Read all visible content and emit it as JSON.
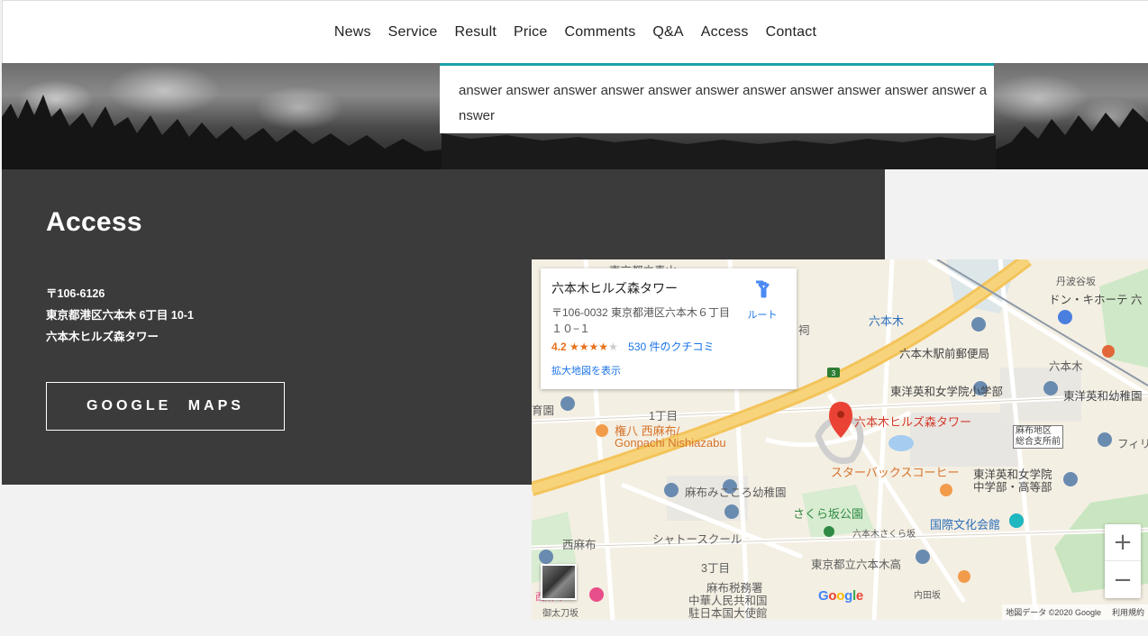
{
  "nav": {
    "items": [
      "News",
      "Service",
      "Result",
      "Price",
      "Comments",
      "Q&A",
      "Access",
      "Contact"
    ]
  },
  "qa": {
    "answer_text": "answer answer answer answer answer answer answer answer answer answer answer answer"
  },
  "access": {
    "title": "Access",
    "postal": "〒106-6126",
    "address": "東京都港区六本木 6丁目 10-1",
    "building": "六本木ヒルズ森タワー",
    "button_label": "GOOGLE MAPS"
  },
  "map": {
    "info": {
      "title": "六本木ヒルズ森タワー",
      "address": "〒106-0032 東京都港区六本木６丁目１０−１",
      "rating": "4.2",
      "stars": "★★★★",
      "reviews": "530 件のクチコミ",
      "enlarge": "拡大地図を表示",
      "route": "ルート"
    },
    "labels": {
      "aoyama": "東京都立青山",
      "tanbazaka": "丹波谷坂",
      "donki": "ドン・キホーテ 六",
      "roppongi": "六本木",
      "post": "六本木駅前郵便局",
      "shrine": "祠",
      "roppongi2": "六本木",
      "toyo_ele": "東洋英和女学院小学部",
      "toyo_kinder": "東洋英和幼稚園",
      "ikuo": "育園",
      "chome1": "1丁目",
      "gonpachi_jp": "権八 西麻布/",
      "gonpachi_en": "Gonpachi Nishiazabu",
      "mori": "六本木ヒルズ森タワー",
      "azabu_branch": "麻布地区\n総合支所前",
      "phil": "フィリ",
      "starbucks": "スターバックスコーヒー",
      "toyo_jr": "東洋英和女学院\n中学部・高等部",
      "kokoro": "麻布みこころ幼稚園",
      "sakurazaka": "さくら坂公園",
      "kokusai": "国際文化会館",
      "nishiazabu": "西麻布",
      "chateau": "シャトースクール",
      "sakurazaka_st": "六本木さくら坂",
      "chome3": "3丁目",
      "azabu_tax": "麻布税務署",
      "roppongi_high": "東京都立六本木高",
      "china": "中華人民共和国\n駐日本国大使館",
      "naidabazaka": "内田坂",
      "gotabi": "御太刀坂",
      "nishiazabu2": "西麻布"
    },
    "footer_data": "地図データ ©2020 Google",
    "footer_terms": "利用規約",
    "zoom_in": "+",
    "zoom_out": "−"
  }
}
